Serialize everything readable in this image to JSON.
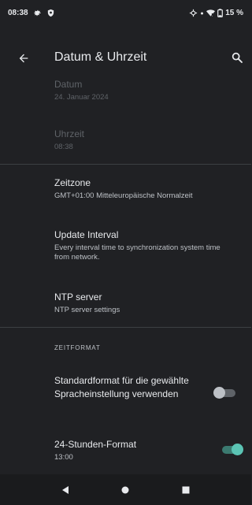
{
  "status_bar": {
    "time": "08:38",
    "battery": "15 %"
  },
  "app_bar": {
    "title": "Datum & Uhrzeit"
  },
  "date": {
    "title": "Datum",
    "value": "24. Januar 2024"
  },
  "time": {
    "title": "Uhrzeit",
    "value": "08:38"
  },
  "timezone": {
    "title": "Zeitzone",
    "value": "GMT+01:00 Mitteleuropäische Normalzeit"
  },
  "update_interval": {
    "title": "Update Interval",
    "summary": "Every interval time to synchronization system time from network."
  },
  "ntp_server": {
    "title": "NTP server",
    "summary": "NTP server settings"
  },
  "time_format_section": {
    "header": "ZEITFORMAT",
    "default_format": {
      "title": "Standardformat für die gewählte Spracheinstellung verwenden",
      "enabled": false
    },
    "format_24h": {
      "title": "24-Stunden-Format",
      "summary": "13:00",
      "enabled": true
    }
  },
  "colors": {
    "background": "#202124",
    "accent": "#5bc4b4",
    "toggle_off_track": "#5f6368",
    "toggle_off_thumb": "#bdc1c6"
  }
}
